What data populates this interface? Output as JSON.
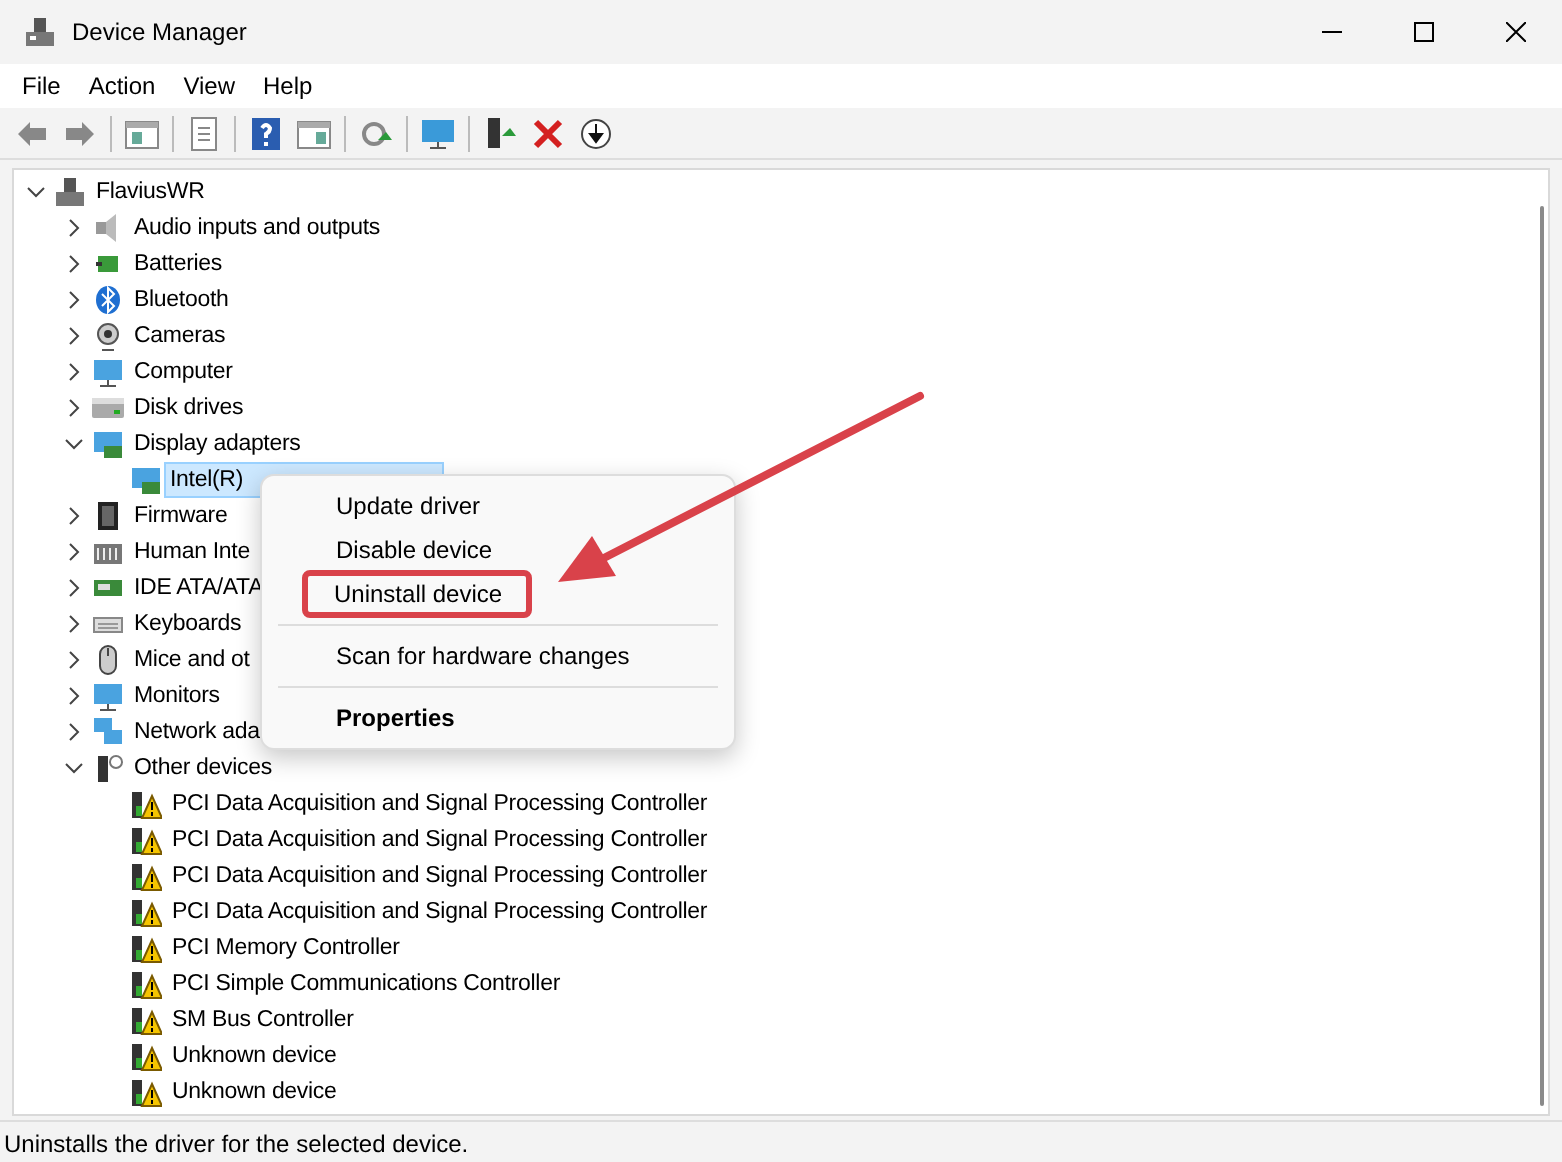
{
  "window": {
    "title": "Device Manager"
  },
  "menu": [
    "File",
    "Action",
    "View",
    "Help"
  ],
  "tree": [
    {
      "label": "FlaviusWR",
      "expanded": true,
      "selected": false,
      "children": [
        {
          "label": "Audio inputs and outputs",
          "expanded": false,
          "selected": false
        },
        {
          "label": "Batteries",
          "expanded": false,
          "selected": false
        },
        {
          "label": "Bluetooth",
          "expanded": false,
          "selected": false
        },
        {
          "label": "Cameras",
          "expanded": false,
          "selected": false
        },
        {
          "label": "Computer",
          "expanded": false,
          "selected": false
        },
        {
          "label": "Disk drives",
          "expanded": false,
          "selected": false
        },
        {
          "label": "Display adapters",
          "expanded": true,
          "selected": false,
          "children": [
            {
              "label": "Intel(R)",
              "selected": true
            }
          ]
        },
        {
          "label": "Firmware",
          "expanded": false,
          "selected": false
        },
        {
          "label": "Human Inte",
          "expanded": false,
          "selected": false
        },
        {
          "label": "IDE ATA/ATA",
          "expanded": false,
          "selected": false
        },
        {
          "label": "Keyboards",
          "expanded": false,
          "selected": false
        },
        {
          "label": "Mice and ot",
          "expanded": false,
          "selected": false
        },
        {
          "label": "Monitors",
          "expanded": false,
          "selected": false
        },
        {
          "label": "Network ada",
          "expanded": false,
          "selected": false
        },
        {
          "label": "Other devices",
          "expanded": true,
          "selected": false,
          "children": [
            {
              "label": "PCI Data Acquisition and Signal Processing Controller",
              "selected": false
            },
            {
              "label": "PCI Data Acquisition and Signal Processing Controller",
              "selected": false
            },
            {
              "label": "PCI Data Acquisition and Signal Processing Controller",
              "selected": false
            },
            {
              "label": "PCI Data Acquisition and Signal Processing Controller",
              "selected": false
            },
            {
              "label": "PCI Memory Controller",
              "selected": false
            },
            {
              "label": "PCI Simple Communications Controller",
              "selected": false
            },
            {
              "label": "SM Bus Controller",
              "selected": false
            },
            {
              "label": "Unknown device",
              "selected": false
            },
            {
              "label": "Unknown device",
              "selected": false
            }
          ]
        }
      ]
    }
  ],
  "context_menu": {
    "items": [
      {
        "kind": "item",
        "label": "Update driver",
        "highlighted": false
      },
      {
        "kind": "item",
        "label": "Disable device",
        "highlighted": false
      },
      {
        "kind": "item",
        "label": "Uninstall device",
        "highlighted": true
      },
      {
        "kind": "separator"
      },
      {
        "kind": "item",
        "label": "Scan for hardware changes",
        "highlighted": false
      },
      {
        "kind": "separator"
      },
      {
        "kind": "default",
        "label": "Properties",
        "highlighted": false
      }
    ]
  },
  "status_bar": "Uninstalls the driver for the selected device."
}
